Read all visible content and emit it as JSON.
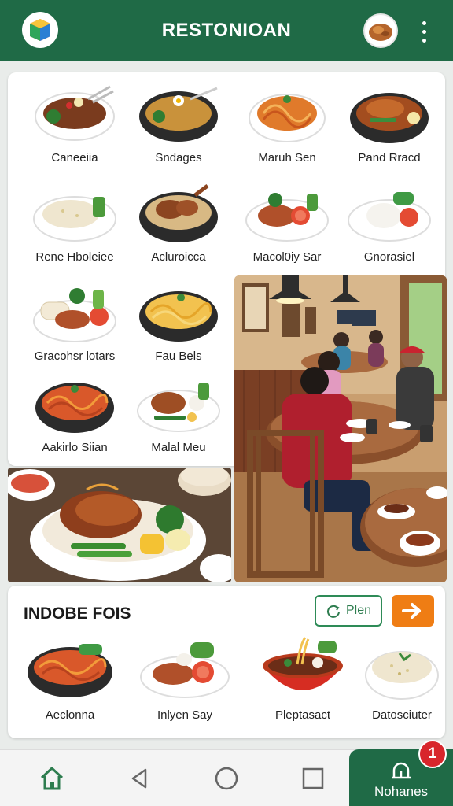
{
  "app": {
    "title": "RESTONIOAN"
  },
  "menu": {
    "items": [
      {
        "label": "Caneeiia",
        "icon": "curry-bowl-icon"
      },
      {
        "label": "Sndages",
        "icon": "soup-bowl-icon"
      },
      {
        "label": "Maruh Sen",
        "icon": "noodle-bowl-icon"
      },
      {
        "label": "Pand Rracd",
        "icon": "chicken-bowl-icon"
      },
      {
        "label": "Rene Hboleiee",
        "icon": "rice-plate-icon"
      },
      {
        "label": "Acluroicca",
        "icon": "roast-bowl-icon"
      },
      {
        "label": "Macol0iy Sar",
        "icon": "grilled-plate-icon"
      },
      {
        "label": "Gnorasiel",
        "icon": "rice-tomato-icon"
      },
      {
        "label": "Gracohsr lotars",
        "icon": "wrap-plate-icon"
      },
      {
        "label": "Fau Bels",
        "icon": "noodle-bowl-icon"
      },
      {
        "label": "Aakirlo Siian",
        "icon": "noodle-bowl-icon"
      },
      {
        "label": "Malal Meu",
        "icon": "chicken-plate-icon"
      }
    ]
  },
  "favorites": {
    "heading": "INDOBE FOIS",
    "plan_label": "Plen",
    "items": [
      {
        "label": "Aeclonna",
        "icon": "noodle-bowl-icon"
      },
      {
        "label": "Inlyen Say",
        "icon": "grilled-plate-icon"
      },
      {
        "label": "Pleptasact",
        "icon": "soup-bowl-icon"
      },
      {
        "label": "Datosciuter",
        "icon": "rice-plate-icon"
      }
    ]
  },
  "nav": {
    "notifications_label": "Nohanes",
    "badge_count": "1"
  },
  "colors": {
    "primary": "#1f6a46",
    "accent": "#ef7d14",
    "badge": "#d8262c"
  }
}
